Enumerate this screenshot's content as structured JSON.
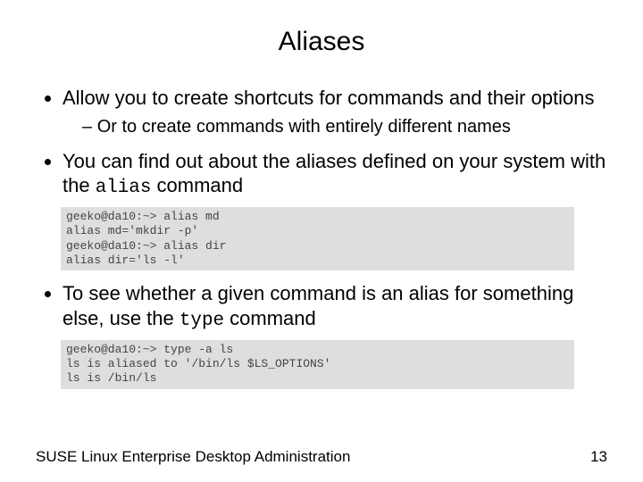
{
  "title": "Aliases",
  "bullets": {
    "b1": "Allow you to create shortcuts for commands and their options",
    "b1_sub1": "Or to create commands with entirely different names",
    "b2_pre": "You can find out about the aliases defined on your system with the ",
    "b2_code": "alias",
    "b2_post": " command",
    "b3_pre": "To see whether a given command is an alias for something else, use the ",
    "b3_code": "type",
    "b3_post": " command"
  },
  "terminal1": "geeko@da10:~> alias md\nalias md='mkdir -p'\ngeeko@da10:~> alias dir\nalias dir='ls -l'",
  "terminal2": "geeko@da10:~> type -a ls\nls is aliased to '/bin/ls $LS_OPTIONS'\nls is /bin/ls",
  "footer": {
    "left": "SUSE Linux Enterprise Desktop Administration",
    "page": "13"
  }
}
